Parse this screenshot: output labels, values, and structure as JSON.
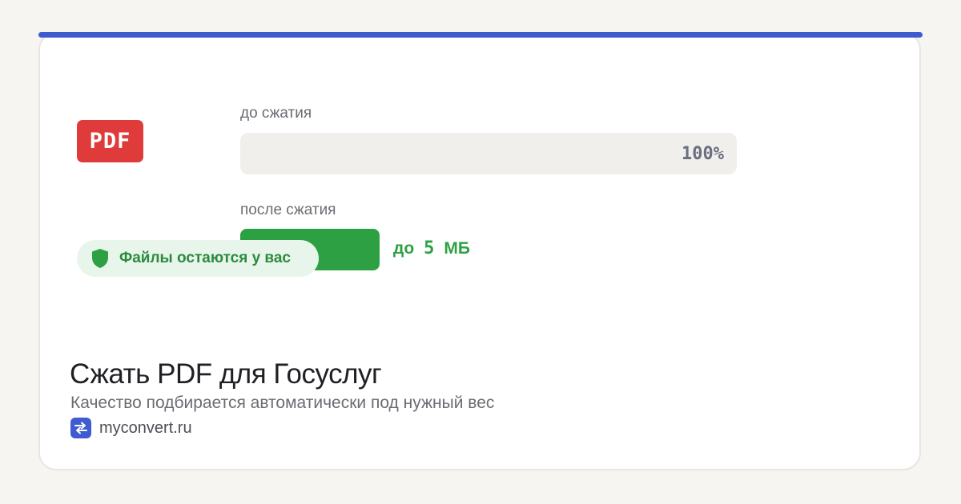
{
  "card": {
    "pdf_badge": "PDF",
    "before_label": "до сжатия",
    "before_percent": "100%",
    "before_fill": 1.0,
    "after_label": "после сжатия",
    "size_prefix": "до",
    "size_value": "5",
    "size_unit": "МБ",
    "privacy_badge": "Файлы остаются у вас",
    "title": "Сжать PDF для Госуслуг",
    "subtitle": "Качество подбирается автоматически под нужный вес",
    "brand_name": "myconvert.ru"
  },
  "icons": {
    "privacy": "shield-icon",
    "brand": "swap-arrows-icon"
  },
  "colors": {
    "accent": "#3f5bd0",
    "pdf_red": "#e03b3b",
    "success_green": "#2ea044",
    "bar_gray": "#f0efeb"
  }
}
